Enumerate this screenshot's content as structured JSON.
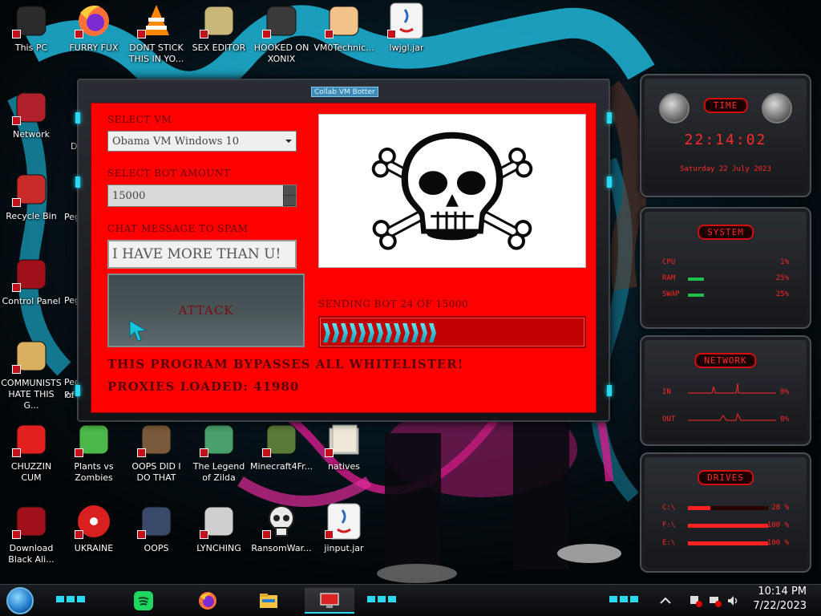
{
  "desktop": {
    "icons": [
      {
        "label": "This PC",
        "icon": "monitor-icon"
      },
      {
        "label": "FURRY FUX",
        "icon": "firefox-icon"
      },
      {
        "label": "DONT STICK THIS IN YO...",
        "icon": "vlc-cone-icon"
      },
      {
        "label": "SEX EDITOR",
        "icon": "hxd-icon"
      },
      {
        "label": "HOOKED ON XONIX",
        "icon": "xonix-icon"
      },
      {
        "label": "VM0Technic...",
        "icon": "doctor-icon"
      },
      {
        "label": "lwjgl.jar",
        "icon": "java-icon"
      },
      {
        "label": "Network",
        "icon": "alien-network-icon"
      },
      {
        "label": "Recycle Bin",
        "icon": "recycle-bin-icon"
      },
      {
        "label": "Control Panel",
        "icon": "control-panel-icon"
      },
      {
        "label": "COMMUNISTS HATE THIS G...",
        "icon": "money-bag-icon"
      },
      {
        "label": "CHUZZIN CUM",
        "icon": "chuzzle-icon"
      },
      {
        "label": "Plants vs Zombies",
        "icon": "plant-icon"
      },
      {
        "label": "OOPS DID I DO THAT",
        "icon": "portrait-icon"
      },
      {
        "label": "The Legend of Zilda",
        "icon": "zelda-icon"
      },
      {
        "label": "Minecraft4Fr...",
        "icon": "minecraft-icon"
      },
      {
        "label": "natives",
        "icon": "folder-icon"
      },
      {
        "label": "Download Black Ali...",
        "icon": "alien-download-icon"
      },
      {
        "label": "UKRAINE",
        "icon": "radiation-icon"
      },
      {
        "label": "OOPS",
        "icon": "oops-icon"
      },
      {
        "label": "LYNCHING",
        "icon": "noose-icon"
      },
      {
        "label": "RansomWar...",
        "icon": "skull-icon"
      },
      {
        "label": "jinput.jar",
        "icon": "java-icon"
      }
    ],
    "partial_labels": [
      "Peg",
      "Peg",
      "Peg",
      "Pe",
      "of",
      "D"
    ]
  },
  "window": {
    "title": "Collab VM Botter",
    "select_vm_label": "SELECT VM",
    "select_vm_value": "Obama VM Windows 10",
    "bot_amount_label": "SELECT BOT AMOUNT",
    "bot_amount_value": "15000",
    "chat_label": "CHAT MESSAGE TO SPAM",
    "chat_value": "I HAVE MORE THAN U!",
    "attack_label": "ATTACK",
    "status": "SENDING BOT 24 OF 15000",
    "progress": {
      "current": 24,
      "total": 15000
    },
    "notice_1": "THIS PROGRAM BYPASSES ALL WHITELISTER!",
    "notice_2": "PROXIES LOADED: 41980",
    "image": "skull-crossbones-icon",
    "colors": {
      "background": "#fe0000",
      "text": "#5a0000",
      "progress": "#29d9f2"
    }
  },
  "widgets": {
    "time": {
      "title": "TIME",
      "clock": "22:14:02",
      "date": "Saturday 22 July 2023"
    },
    "system": {
      "title": "SYSTEM",
      "rows": [
        {
          "label": "CPU",
          "value": "1%"
        },
        {
          "label": "RAM",
          "value": "25%"
        },
        {
          "label": "SWAP",
          "value": "25%"
        }
      ]
    },
    "network": {
      "title": "NETWORK",
      "rows": [
        {
          "label": "IN",
          "value": "0%"
        },
        {
          "label": "OUT",
          "value": "0%"
        }
      ]
    },
    "drives": {
      "title": "DRIVES",
      "rows": [
        {
          "label": "C:\\",
          "value": "28 %",
          "level": 0.28
        },
        {
          "label": "F:\\",
          "value": "100 %",
          "level": 1.0
        },
        {
          "label": "E:\\",
          "value": "100 %",
          "level": 1.0
        }
      ]
    }
  },
  "taskbar": {
    "apps": [
      "spotify-icon",
      "firefox-icon",
      "file-explorer-icon",
      "collab-vm-botter-icon"
    ],
    "clock_time": "10:14 PM",
    "clock_date": "7/22/2023"
  }
}
